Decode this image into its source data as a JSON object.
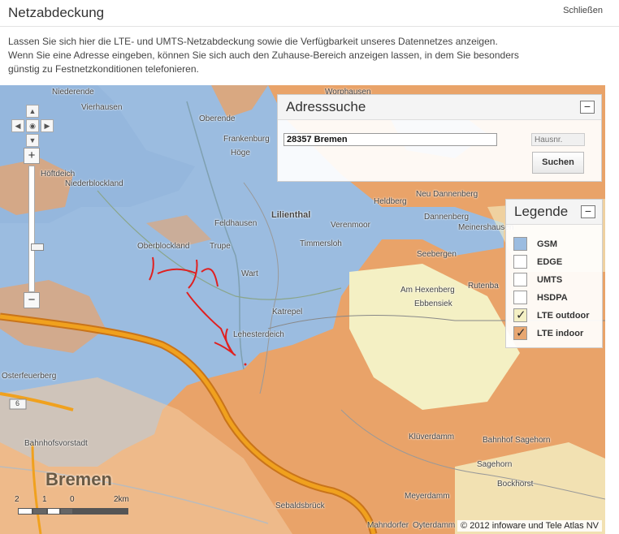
{
  "dialog": {
    "title": "Netzabdeckung",
    "close_label": "Schließen"
  },
  "intro": {
    "line1": "Lassen Sie sich hier die LTE- und UMTS-Netzabdeckung sowie die Verfügbarkeit unseres Datennetzes anzeigen.",
    "line2": "Wenn Sie eine Adresse eingeben, können Sie sich auch den Zuhause-Bereich anzeigen lassen, in dem Sie besonders",
    "line3": "günstig zu Festnetzkonditionen telefonieren."
  },
  "address_search": {
    "title": "Adresssuche",
    "collapse_label": "−",
    "street_value": "28357 Bremen",
    "house_placeholder": "Hausnr.",
    "search_label": "Suchen"
  },
  "legend": {
    "title": "Legende",
    "collapse_label": "−",
    "items": [
      {
        "label": "GSM",
        "color": "#9bbce0",
        "checked": false
      },
      {
        "label": "EDGE",
        "color": "#ffffff",
        "checked": false
      },
      {
        "label": "UMTS",
        "color": "#ffffff",
        "checked": false
      },
      {
        "label": "HSDPA",
        "color": "#ffffff",
        "checked": false
      },
      {
        "label": "LTE outdoor",
        "color": "#f4f0c4",
        "checked": true
      },
      {
        "label": "LTE indoor",
        "color": "#e8a771",
        "checked": true
      }
    ]
  },
  "map": {
    "colors": {
      "lte_indoor": "#e9a369",
      "gsm": "#9bbce0",
      "lte_outdoor": "#f4f0c4",
      "motorway": "#f0a11e"
    },
    "places": [
      "Worphausen",
      "Niederende",
      "Vierhausen",
      "Oberende",
      "Frankenburg",
      "Höge",
      "Höftdeich",
      "Niederblockland",
      "Heldberg",
      "Neu Dannenberg",
      "Dannenberg",
      "Meinershausen",
      "Feldhausen",
      "Lilienthal",
      "Verenmoor",
      "Oberblockland",
      "Trupe",
      "Timmersloh",
      "Seebergen",
      "Wart",
      "Am Hexenberg",
      "Rutenba",
      "Ebbensiek",
      "Katrepel",
      "Lehesterdeich",
      "Osterfeuerberg",
      "Bahnhofsvorstadt",
      "Klüverdamm",
      "Bahnhof Sagehorn",
      "Sagehorn",
      "Bockhorst",
      "Meyerdamm",
      "Sebaldsbrück",
      "Oyterdamm",
      "Mahndorfer",
      "Bremen"
    ],
    "motorway_shield": "6",
    "scale_labels": [
      "2",
      "1",
      "0",
      "2km"
    ],
    "copyright": "© 2012 infoware und Tele Atlas NV"
  }
}
